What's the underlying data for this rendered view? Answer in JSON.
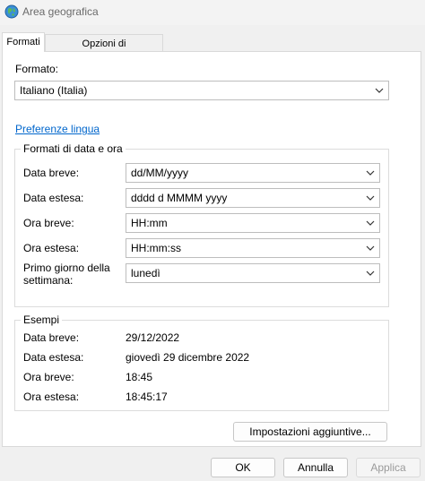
{
  "window": {
    "title": "Area geografica"
  },
  "tabs": [
    {
      "label": "Formati",
      "active": true
    },
    {
      "label": "Opzioni di amministrazione",
      "active": false
    }
  ],
  "format": {
    "label": "Formato:",
    "value": "Italiano (Italia)"
  },
  "language_link": "Preferenze lingua",
  "date_time_formats": {
    "title": "Formati di data e ora",
    "rows": [
      {
        "label": "Data breve:",
        "value": "dd/MM/yyyy"
      },
      {
        "label": "Data estesa:",
        "value": "dddd d MMMM yyyy"
      },
      {
        "label": "Ora breve:",
        "value": "HH:mm"
      },
      {
        "label": "Ora estesa:",
        "value": "HH:mm:ss"
      },
      {
        "label": "Primo giorno della settimana:",
        "value": "lunedì"
      }
    ]
  },
  "examples": {
    "title": "Esempi",
    "rows": [
      {
        "label": "Data breve:",
        "value": "29/12/2022"
      },
      {
        "label": "Data estesa:",
        "value": "giovedì 29 dicembre 2022"
      },
      {
        "label": "Ora breve:",
        "value": "18:45"
      },
      {
        "label": "Ora estesa:",
        "value": "18:45:17"
      }
    ]
  },
  "buttons": {
    "additional_settings": "Impostazioni aggiuntive...",
    "ok": "OK",
    "cancel": "Annulla",
    "apply": "Applica"
  },
  "colors": {
    "link": "#0066cc",
    "disabled_text": "#9a9a9a"
  },
  "icons": {
    "app": "globe-icon",
    "dropdown": "chevron-down-icon"
  }
}
